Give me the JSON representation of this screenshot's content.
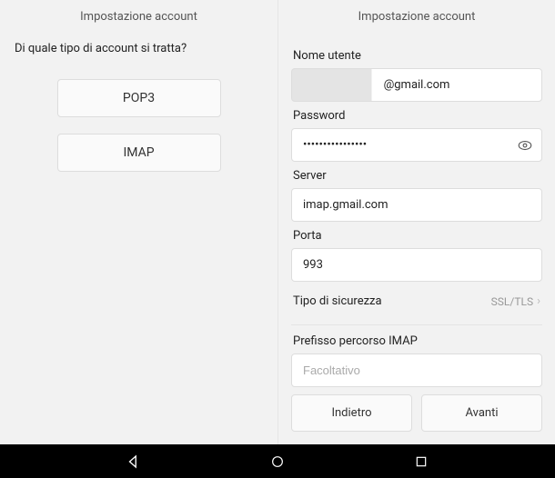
{
  "left": {
    "title": "Impostazione account",
    "question": "Di quale tipo di account si tratta?",
    "pop3": "POP3",
    "imap": "IMAP"
  },
  "right": {
    "title": "Impostazione account",
    "username_label": "Nome utente",
    "username_value": "@gmail.com",
    "password_label": "Password",
    "password_value": "••••••••••••••••",
    "server_label": "Server",
    "server_value": "imap.gmail.com",
    "port_label": "Porta",
    "port_value": "993",
    "security_label": "Tipo di sicurezza",
    "security_value": "SSL/TLS",
    "prefix_label": "Prefisso percorso IMAP",
    "prefix_placeholder": "Facoltativo",
    "back": "Indietro",
    "next": "Avanti"
  }
}
